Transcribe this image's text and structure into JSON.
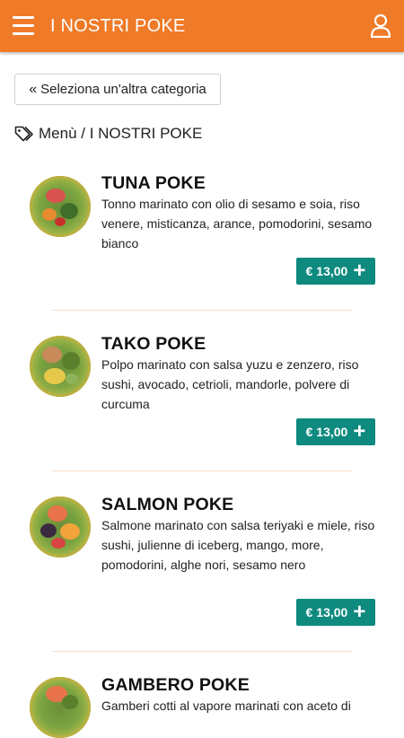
{
  "header": {
    "title": "I NOSTRI POKE",
    "menu_icon": "hamburger-menu-icon",
    "user_icon": "user-icon",
    "accent_color": "#ef7a27"
  },
  "back_button": {
    "label": "Seleziona un'altra categoria",
    "icon": "double-chevron-left-icon"
  },
  "breadcrumb": {
    "icon": "tags-icon",
    "text": "Menù / I NOSTRI POKE"
  },
  "price_color": "#0e8a7e",
  "items": [
    {
      "name": "TUNA POKE",
      "description": "Tonno marinato con olio di sesamo e soia, riso venere, misticanza, arance, pomodorini, sesamo bianco",
      "price": "€ 13,00"
    },
    {
      "name": "TAKO POKE",
      "description": "Polpo marinato con salsa yuzu e zenzero, riso sushi, avocado, cetrioli, mandorle, polvere di curcuma",
      "price": "€ 13,00"
    },
    {
      "name": "SALMON POKE",
      "description": "Salmone marinato con salsa teriyaki e miele, riso sushi, julienne di iceberg, mango, more, pomodorini, alghe nori, sesamo nero",
      "price": "€ 13,00"
    },
    {
      "name": "GAMBERO POKE",
      "description": "Gamberi cotti al vapore marinati con aceto di"
    }
  ]
}
